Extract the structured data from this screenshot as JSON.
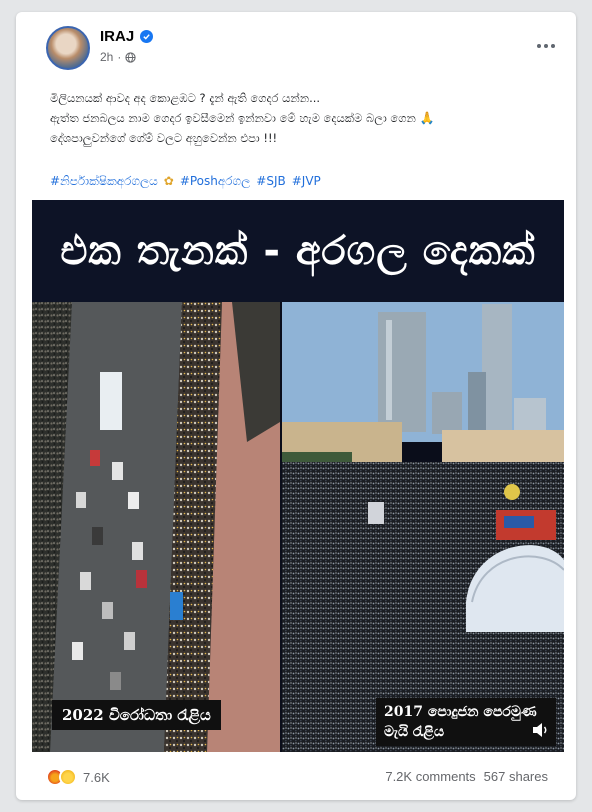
{
  "post": {
    "author": "IRAJ",
    "time": "2h",
    "text_lines": [
      "මිලියනයක් ආවද අද කොළඹට ? දැන් ඇති ගෙදර යන්න...",
      "ඇත්ත ජනබලය නාම ගෙදර ඉවසීමෙන් ඉන්නවා මේ හැම දෙයක්ම බලා ගෙන",
      "දේශපාලුවන්ගේ ගේම් වලට අහුවෙන්න එපා !!!"
    ],
    "hashtags": [
      "#නිර්පාක්ෂිකඅරගලය",
      "#Poshඅරගල",
      "#SJB",
      "#JVP"
    ]
  },
  "image": {
    "banner_title": "එක තැනක් - අරගල දෙකක්",
    "left_caption": "2022 විරෝධතා රැළිය",
    "right_caption": "2017 පොදුජන පෙරමුණ මැයි රැළිය"
  },
  "footer": {
    "reactions_count": "7.6K",
    "comments": "7.2K comments",
    "shares": "567 shares"
  },
  "colors": {
    "link": "#216fdb",
    "verified": "#1877f2",
    "banner_bg": "#0d1326"
  },
  "icons": [
    "verified-icon",
    "globe-icon",
    "more-icon",
    "pray-icon",
    "flower-icon",
    "angry-icon",
    "haha-icon",
    "speaker-icon"
  ]
}
